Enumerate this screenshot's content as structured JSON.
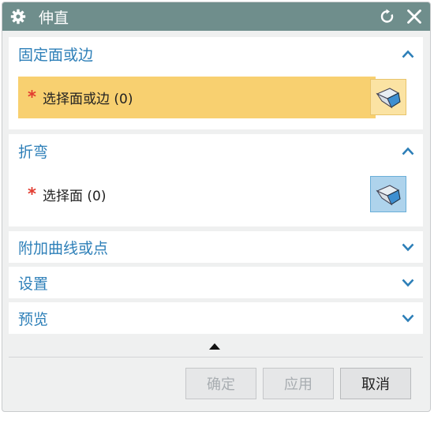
{
  "titlebar": {
    "title": "伸直",
    "icons": {
      "app": "gear-icon",
      "reset": "reset-icon",
      "close": "close-icon"
    }
  },
  "sections": {
    "fixed_face": {
      "title": "固定面或边",
      "expanded": true,
      "select_label": "选择面或边 (0)",
      "required_mark": "*"
    },
    "bend": {
      "title": "折弯",
      "expanded": true,
      "select_label": "选择面 (0)",
      "required_mark": "*"
    },
    "extra": {
      "title": "附加曲线或点",
      "expanded": false
    },
    "settings": {
      "title": "设置",
      "expanded": false
    },
    "preview": {
      "title": "预览",
      "expanded": false
    }
  },
  "buttons": {
    "ok": {
      "label": "确定",
      "enabled": false
    },
    "apply": {
      "label": "应用",
      "enabled": false
    },
    "cancel": {
      "label": "取消",
      "enabled": true
    }
  },
  "colors": {
    "titlebar": "#6f8e8c",
    "section_title": "#2d7fb8",
    "active_row": "#f8d070",
    "required": "#e23b2f"
  }
}
